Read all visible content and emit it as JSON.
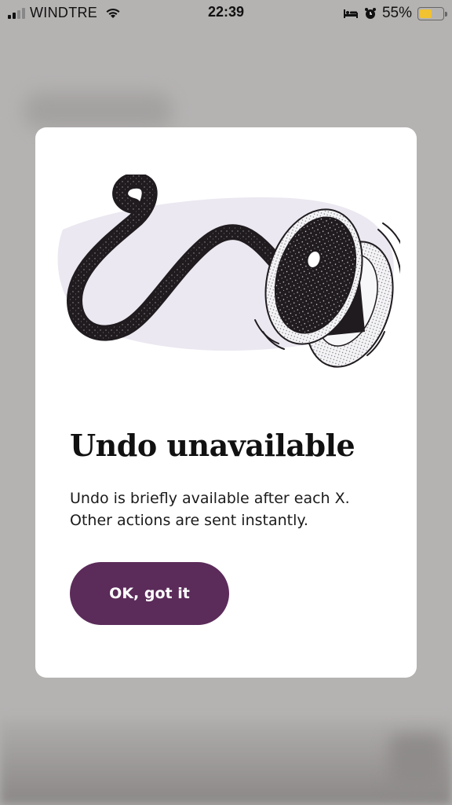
{
  "status_bar": {
    "carrier": "WINDTRE",
    "time": "22:39",
    "battery_percent": "55%",
    "battery_level": 0.55,
    "battery_color": "#f1c232",
    "icons": [
      "signal-icon",
      "wifi-icon",
      "bed-icon",
      "alarm-icon",
      "battery-icon"
    ]
  },
  "dialog": {
    "illustration": "tape-reel-illustration",
    "title": "Undo unavailable",
    "body_line1": "Undo is briefly available after each X.",
    "body_line2": "Other actions are sent instantly.",
    "button_label": "OK, got it",
    "button_color": "#5b2b5a"
  }
}
